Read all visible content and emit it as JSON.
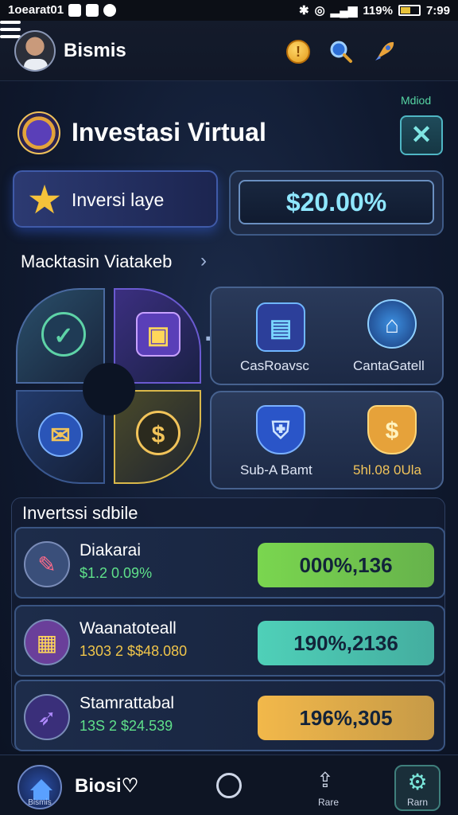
{
  "status_bar": {
    "left_text": "1oearat01",
    "right_text": "119%",
    "time": "7:99"
  },
  "header": {
    "app_name": "Bismis"
  },
  "section": {
    "tiny_label": "Mdiod",
    "title": "Investasi Virtual",
    "left_card_label": "Inversi laye",
    "amount": "$20.00%",
    "subtitle": "Macktasin Viatakeb"
  },
  "panels": {
    "top_left_label": "CasRoavsc",
    "top_right_label": "CantaGatell",
    "bottom_left_label": "Sub-A Bamt",
    "bottom_right_label": "5hl.08 0Ula"
  },
  "list": {
    "title": "Invertssi sdbile",
    "rows": [
      {
        "name": "Diakarai",
        "sub": "$1.2 0.09%",
        "value": "000%,136",
        "sub_color": "#5fe08a",
        "pill_color": "#7ad64f"
      },
      {
        "name": "Waanatoteall",
        "sub": "1303 2 $$48.080",
        "value": "190%,2136",
        "sub_color": "#f0c54a",
        "pill_color": "#4fd0b8"
      },
      {
        "name": "Stamrattabal",
        "sub": "13S 2 $24.539",
        "value": "196%,305",
        "sub_color": "#5fe08a",
        "pill_color": "#f2b84a"
      }
    ]
  },
  "bottom_nav": {
    "home_label": "Bismis",
    "main_text": "Biosi",
    "share_label": "Rare",
    "settings_label": "Rarn"
  }
}
